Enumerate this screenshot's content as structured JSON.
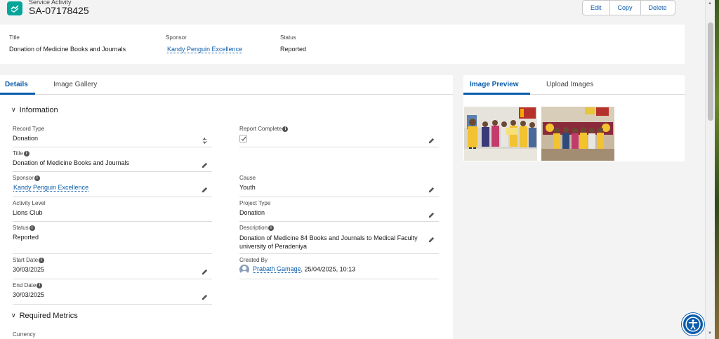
{
  "header": {
    "object_type": "Service Activity",
    "record_name": "SA-07178425",
    "actions": [
      "Edit",
      "Copy",
      "Delete"
    ]
  },
  "highlights": {
    "title_label": "Title",
    "title_value": "Donation of Medicine Books and Journals",
    "sponsor_label": "Sponsor",
    "sponsor_value": "Kandy Penguin Excellence",
    "status_label": "Status",
    "status_value": "Reported"
  },
  "left_tabs": [
    "Details",
    "Image Gallery"
  ],
  "right_tabs": [
    "Image Preview",
    "Upload Images"
  ],
  "sections": {
    "information": "Information",
    "required_metrics": "Required Metrics"
  },
  "fields": {
    "record_type": {
      "label": "Record Type",
      "value": "Donation"
    },
    "report_complete": {
      "label": "Report Complete",
      "checked": true
    },
    "title": {
      "label": "Title",
      "value": "Donation of Medicine Books and Journals"
    },
    "sponsor": {
      "label": "Sponsor",
      "value": "Kandy Penguin Excellence"
    },
    "cause": {
      "label": "Cause",
      "value": "Youth"
    },
    "activity_level": {
      "label": "Activity Level",
      "value": "Lions Club"
    },
    "project_type": {
      "label": "Project Type",
      "value": "Donation"
    },
    "status": {
      "label": "Status",
      "value": "Reported"
    },
    "description": {
      "label": "Description",
      "value": "Donation of Medicine 84 Books and Journals to Medical Faculty university of Peradeniya"
    },
    "start_date": {
      "label": "Start Date",
      "value": "30/03/2025"
    },
    "created_by": {
      "label": "Created By",
      "user": "Prabath Gamage",
      "timestamp": ", 25/04/2025, 10:13"
    },
    "end_date": {
      "label": "End Date",
      "value": "30/03/2025"
    },
    "currency": {
      "label": "Currency"
    }
  },
  "colors": {
    "accent": "#0b5cab",
    "brand_icon": "#06a59a"
  }
}
